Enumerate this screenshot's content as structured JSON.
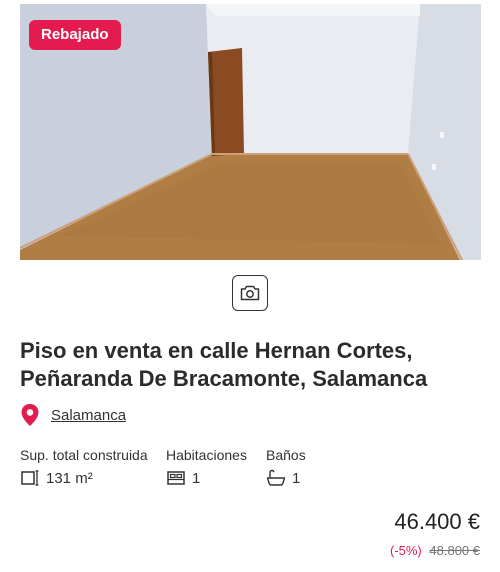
{
  "listing": {
    "badge": "Rebajado",
    "title": "Piso en venta en calle Hernan Cortes, Peñaranda De Bracamonte, Salamanca",
    "location": "Salamanca",
    "features": [
      {
        "label": "Sup. total construida",
        "value": "131 m²",
        "icon": "area-icon"
      },
      {
        "label": "Habitaciones",
        "value": "1",
        "icon": "bed-icon"
      },
      {
        "label": "Baños",
        "value": "1",
        "icon": "bathtub-icon"
      }
    ],
    "price": "46.400 €",
    "discount": "(-5%)",
    "old_price": "48.800 €"
  },
  "colors": {
    "accent": "#e31b4f",
    "text": "#333333"
  },
  "icons": [
    "camera-icon",
    "location-pin-icon",
    "area-icon",
    "bed-icon",
    "bathtub-icon"
  ]
}
